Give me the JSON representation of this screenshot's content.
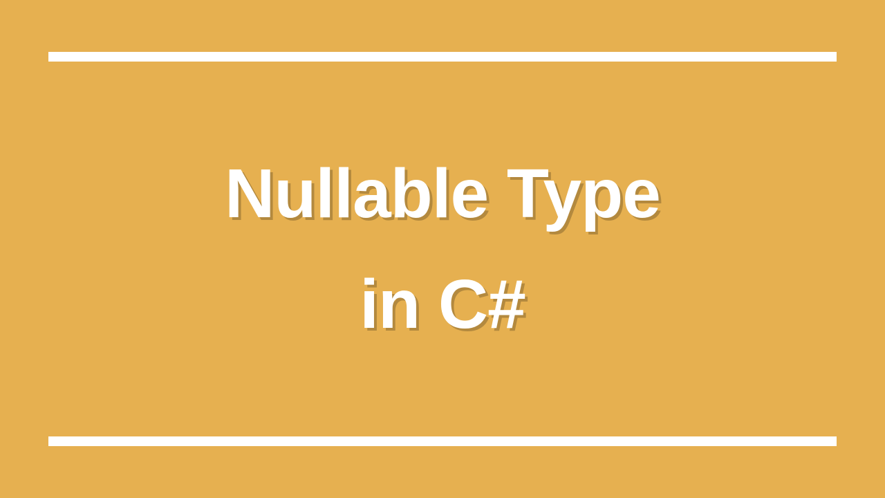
{
  "title": {
    "line1": "Nullable Type",
    "line2": "in C#"
  },
  "colors": {
    "background": "#e6b050",
    "text": "#ffffff",
    "rule": "#ffffff"
  }
}
